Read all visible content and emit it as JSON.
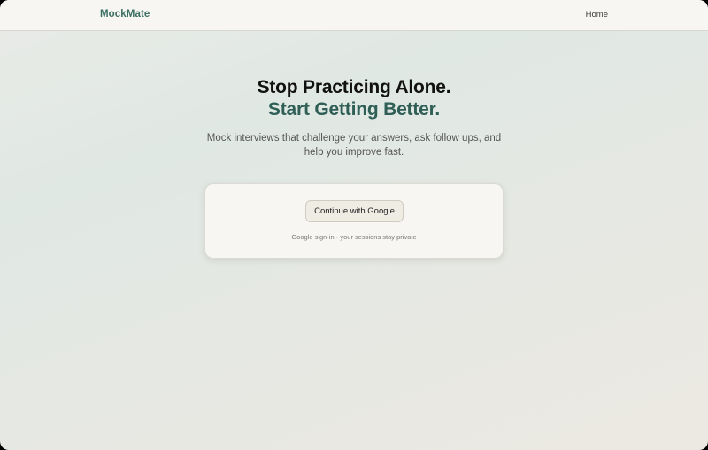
{
  "navbar": {
    "brand": "MockMate",
    "links": [
      "Home"
    ]
  },
  "hero": {
    "title_line1": "Stop Practicing Alone.",
    "title_line2": "Start Getting Better.",
    "subtitle": "Mock interviews that challenge your answers, ask follow ups, and help you improve fast."
  },
  "signin_card": {
    "button_label": "Continue with Google",
    "note": "Google sign-in · your sessions stay private"
  },
  "colors": {
    "brand": "#3a6e63",
    "accent_title": "#2e5e55",
    "card_bg": "#f7f6f2"
  }
}
